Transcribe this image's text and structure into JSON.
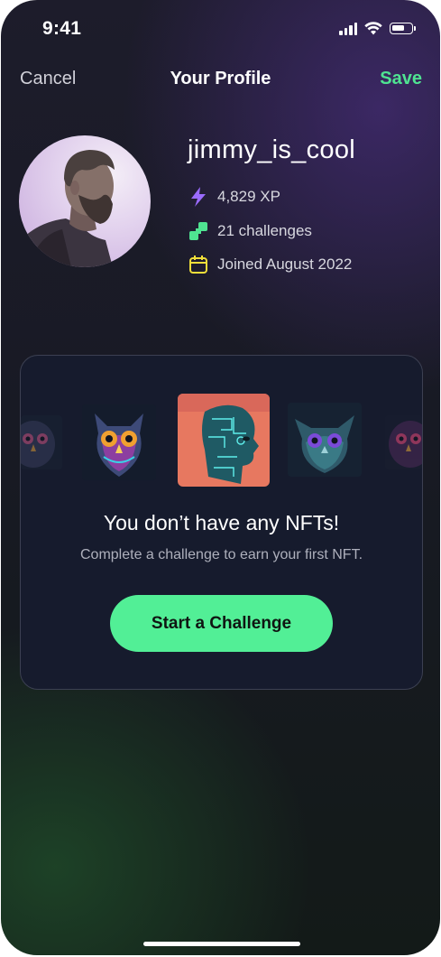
{
  "status_bar": {
    "time": "9:41"
  },
  "nav": {
    "cancel": "Cancel",
    "title": "Your Profile",
    "save": "Save"
  },
  "profile": {
    "username": "jimmy_is_cool",
    "xp": "4,829 XP",
    "challenges": "21 challenges",
    "joined": "Joined August 2022"
  },
  "empty_state": {
    "title": "You don’t have any NFTs!",
    "subtitle": "Complete a challenge to earn your first NFT.",
    "cta": "Start a Challenge"
  },
  "colors": {
    "accent_green": "#52ef96",
    "xp_purple": "#9b6bff",
    "challenge_green": "#4fe391",
    "calendar_yellow": "#f1df3a"
  },
  "icons": {
    "xp": "lightning-icon",
    "challenges": "challenge-blocks-icon",
    "joined": "calendar-icon"
  }
}
